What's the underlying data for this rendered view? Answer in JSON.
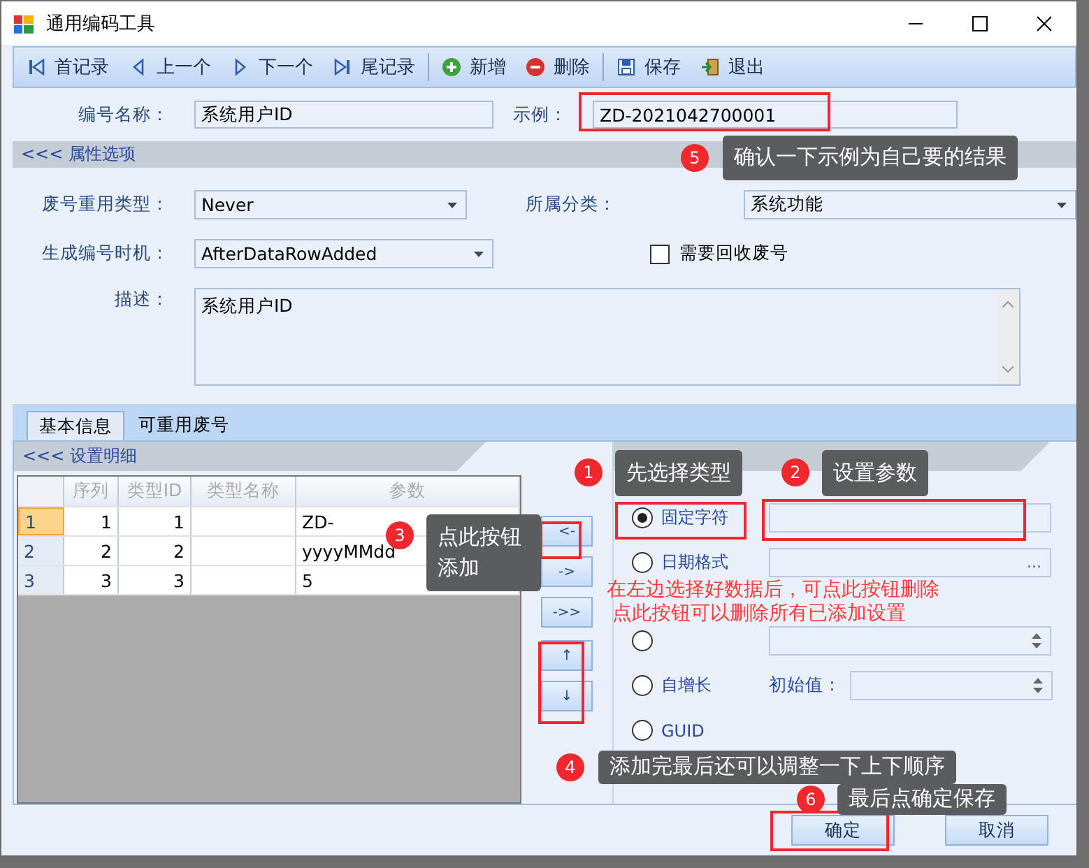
{
  "window": {
    "title": "通用编码工具"
  },
  "toolbar": [
    [
      {
        "label": "首记录",
        "kind": "first"
      },
      {
        "label": "上一个",
        "kind": "prev"
      },
      {
        "label": "下一个",
        "kind": "next"
      },
      {
        "label": "尾记录",
        "kind": "last"
      }
    ],
    [
      {
        "label": "新增",
        "kind": "add"
      },
      {
        "label": "删除",
        "kind": "delete"
      }
    ],
    [
      {
        "label": "保存",
        "kind": "save"
      },
      {
        "label": "退出",
        "kind": "exit"
      }
    ]
  ],
  "header_fields": [
    {
      "label": "编号名称：",
      "value": "系统用户ID"
    },
    {
      "label": "示例：",
      "value": "ZD-2021042700001"
    }
  ],
  "properties": {
    "title": "<<< 属性选项",
    "reuse_type": {
      "label": "废号重用类型：",
      "value": "Never"
    },
    "category": {
      "label": "所属分类：",
      "value": "系统功能"
    },
    "timing": {
      "label": "生成编号时机：",
      "value": "AfterDataRowAdded"
    },
    "recycle": {
      "label": "需要回收废号",
      "checked": false
    },
    "description": {
      "label": "描述：",
      "value": "系统用户ID"
    }
  },
  "tabs": [
    {
      "label": "基本信息",
      "selected": true
    },
    {
      "label": "可重用废号",
      "selected": false
    }
  ],
  "detail": {
    "title": "<<< 设置明细",
    "columns": [
      "序列",
      "类型ID",
      "类型名称",
      "参数"
    ],
    "rows": [
      {
        "header": "1",
        "selected": true,
        "seq": "1",
        "type_id": "1",
        "param": "ZD-"
      },
      {
        "header": "2",
        "selected": false,
        "seq": "2",
        "type_id": "2",
        "param": "yyyyMMdd"
      },
      {
        "header": "3",
        "selected": false,
        "seq": "3",
        "type_id": "3",
        "param": "5"
      }
    ]
  },
  "move_buttons": [
    "<-",
    "->",
    "->>",
    "↑",
    "↓"
  ],
  "types": [
    {
      "kind": "text",
      "label": "固定字符",
      "selected": true
    },
    {
      "kind": "picker",
      "label": "日期格式",
      "selected": false,
      "button": "..."
    },
    {
      "kind": "spin",
      "selected": false
    },
    {
      "kind": "seed",
      "label": "自增长",
      "selected": false,
      "seed_label": "初始值："
    },
    {
      "kind": "none",
      "label": "GUID",
      "selected": false
    }
  ],
  "footer_buttons": [
    "确定",
    "取消"
  ],
  "callouts": [
    {
      "number": "1",
      "text": "先选择类型"
    },
    {
      "number": "2",
      "text": "设置参数"
    },
    {
      "number": "3",
      "text": "点此按钮添加"
    },
    {
      "number": "4",
      "text": "添加完最后还可以调整一下上下顺序"
    },
    {
      "number": "5",
      "text": "确认一下示例为自己要的结果"
    },
    {
      "number": "6",
      "text": "最后点确定保存"
    }
  ],
  "notes": [
    "在左边选择好数据后，可点此按钮删除",
    "点此按钮可以删除所有已添加设置"
  ]
}
